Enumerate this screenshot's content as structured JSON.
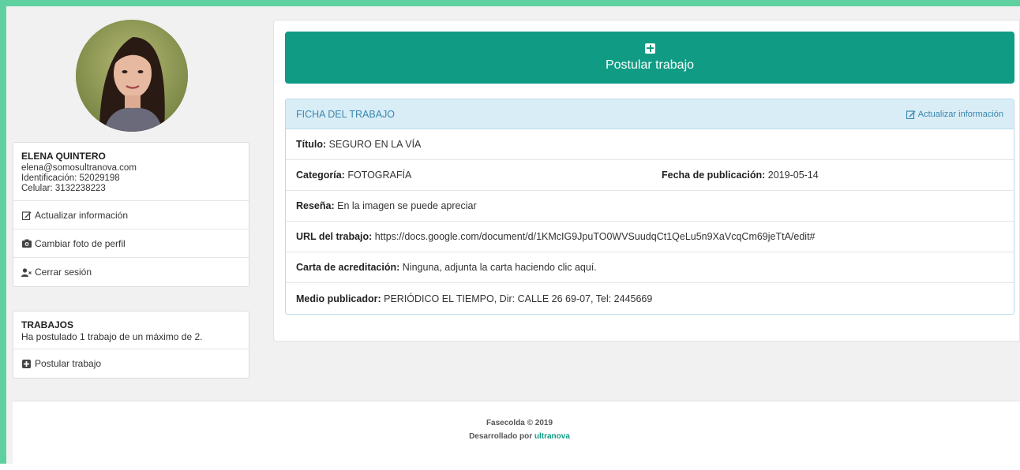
{
  "profile": {
    "name": "ELENA QUINTERO",
    "email": "elena@somosultranova.com",
    "identificacion": "Identificación: 52029198",
    "celular": "Celular: 3132238223",
    "menu": {
      "update": "Actualizar información",
      "photo": "Cambiar foto de perfil",
      "logout": "Cerrar sesión"
    }
  },
  "jobs": {
    "title": "TRABAJOS",
    "summary": "Ha postulado 1 trabajo de un máximo de 2.",
    "apply": "Postular trabajo"
  },
  "main": {
    "apply_button": "Postular trabajo",
    "ficha": {
      "title": "FICHA DEL TRABAJO",
      "update": "Actualizar información",
      "titulo_label": "Título:",
      "titulo_value": "SEGURO EN LA VÍA",
      "categoria_label": "Categoría:",
      "categoria_value": "FOTOGRAFÍA",
      "fecha_label": "Fecha de publicación:",
      "fecha_value": "2019-05-14",
      "resena_label": "Reseña:",
      "resena_value": "En la imagen se puede apreciar",
      "url_label": "URL del trabajo:",
      "url_value": "https://docs.google.com/document/d/1KMcIG9JpuTO0WVSuudqCt1QeLu5n9XaVcqCm69jeTtA/edit#",
      "carta_label": "Carta de acreditación:",
      "carta_value": "Ninguna, adjunta la carta haciendo clic aquí.",
      "medio_label": "Medio publicador:",
      "medio_value": "PERIÓDICO EL TIEMPO, Dir: CALLE 26 69-07, Tel: 2445669"
    }
  },
  "footer": {
    "line1": "Fasecolda © 2019",
    "line2_prefix": "Desarrollado por",
    "line2_brand": "ultranova"
  },
  "colors": {
    "accent": "#109c84",
    "frame": "#5fd1a1",
    "panel_header": "#d9edf7"
  }
}
